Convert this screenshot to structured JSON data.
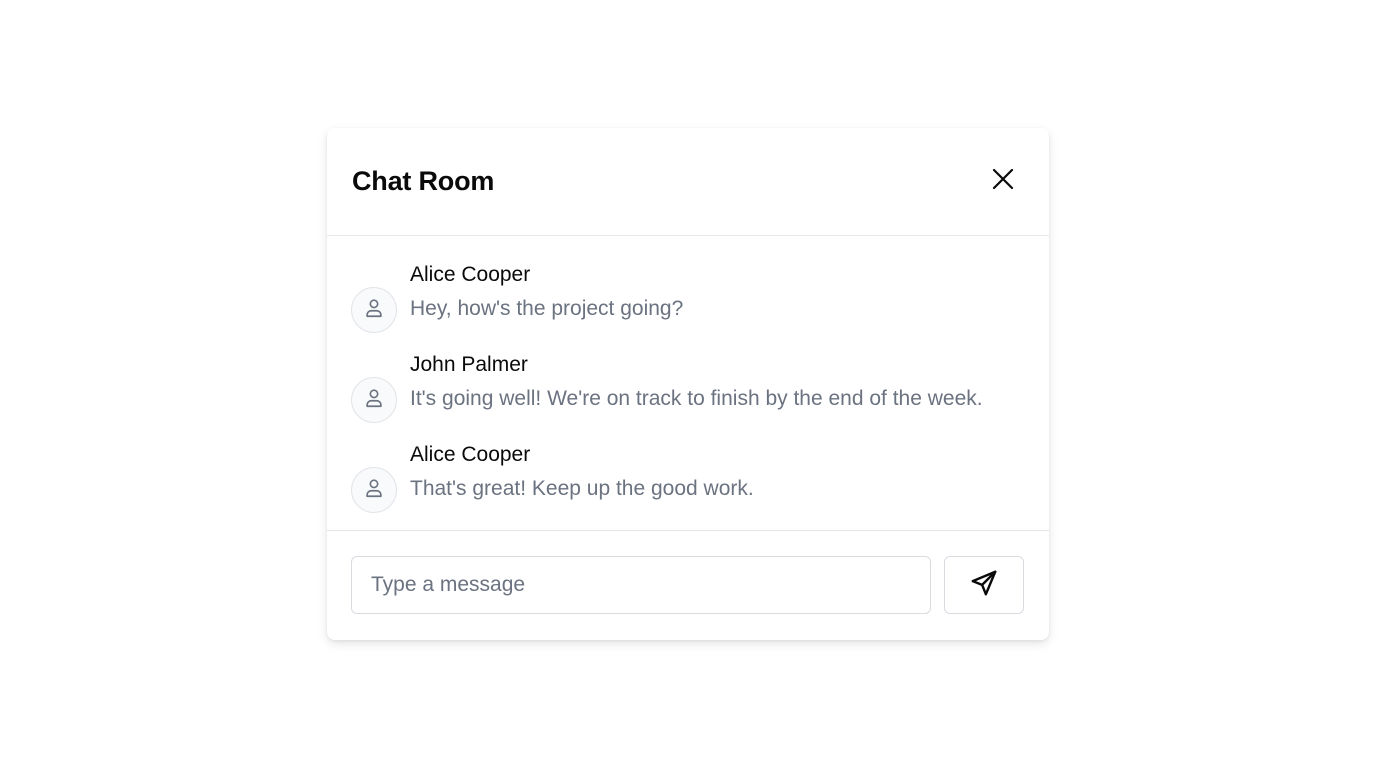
{
  "header": {
    "title": "Chat Room",
    "close_icon": "close-icon"
  },
  "messages": [
    {
      "sender": "Alice Cooper",
      "text": "Hey, how's the project going?",
      "avatar_icon": "user-icon"
    },
    {
      "sender": "John Palmer",
      "text": "It's going well! We're on track to finish by the end of the week.",
      "avatar_icon": "user-icon"
    },
    {
      "sender": "Alice Cooper",
      "text": "That's great! Keep up the good work.",
      "avatar_icon": "user-icon"
    }
  ],
  "composer": {
    "placeholder": "Type a message",
    "value": "",
    "send_icon": "send-icon"
  },
  "colors": {
    "title": "#0a0a0a",
    "sender": "#0a0a0a",
    "message_text": "#6b7280",
    "border": "#e5e7eb"
  }
}
